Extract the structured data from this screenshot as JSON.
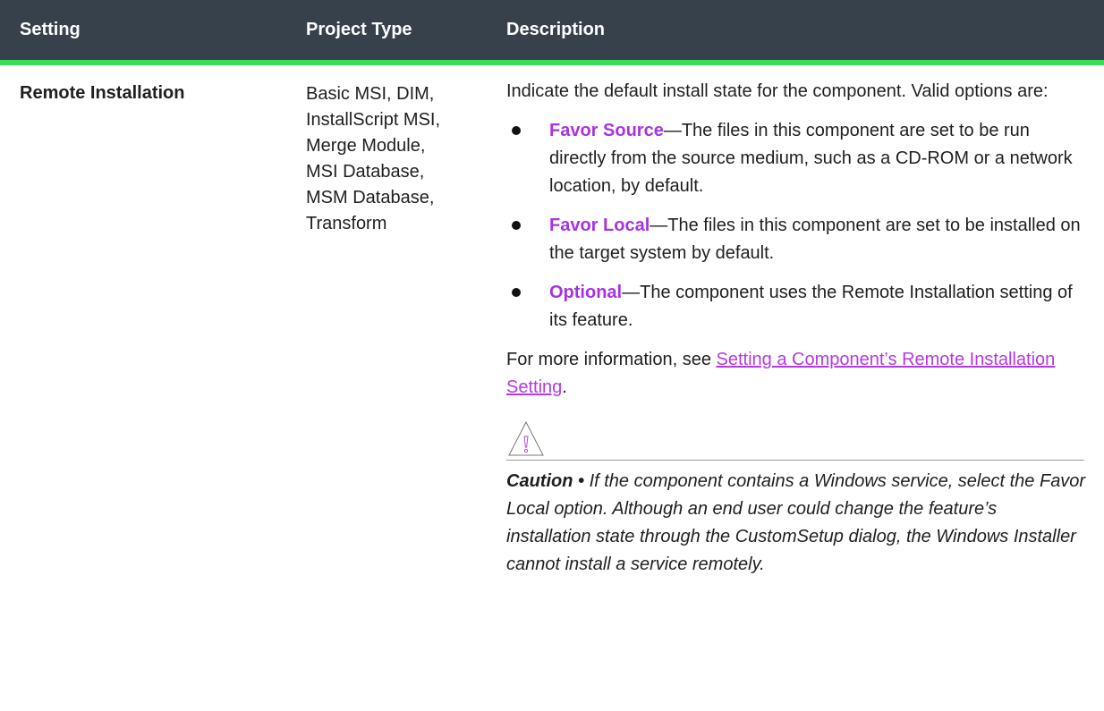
{
  "headers": {
    "setting": "Setting",
    "project_type": "Project Type",
    "description": "Description"
  },
  "row": {
    "setting": "Remote Installation",
    "project_types": [
      "Basic MSI, DIM,",
      "InstallScript MSI,",
      "Merge Module,",
      "MSI Database,",
      "MSM Database,",
      "Transform"
    ],
    "intro": "Indicate the default install state for the component. Valid options are:",
    "options": [
      {
        "term": "Favor Source",
        "text": "—The files in this component are set to be run directly from the source medium, such as a CD-ROM or a network location, by default."
      },
      {
        "term": "Favor Local",
        "text": "—The files in this component are set to be installed on the target system by default."
      },
      {
        "term": "Optional",
        "text": "—The component uses the Remote Installation setting of its feature."
      }
    ],
    "more_prefix": "For more information, see ",
    "more_link": "Setting a Component’s Remote Installation Setting",
    "more_suffix": ".",
    "caution_icon": "warning-triangle-icon",
    "caution_label": "Caution • ",
    "caution_text": "If the component contains a Windows service, select the Favor Local option. Although an end user could change the feature’s installation state through the CustomSetup dialog, the Windows Installer cannot install a service remotely."
  },
  "colors": {
    "header_bg": "#36414c",
    "header_accent": "#3ddc56",
    "term": "#a634e0",
    "link": "#b43ae6"
  }
}
